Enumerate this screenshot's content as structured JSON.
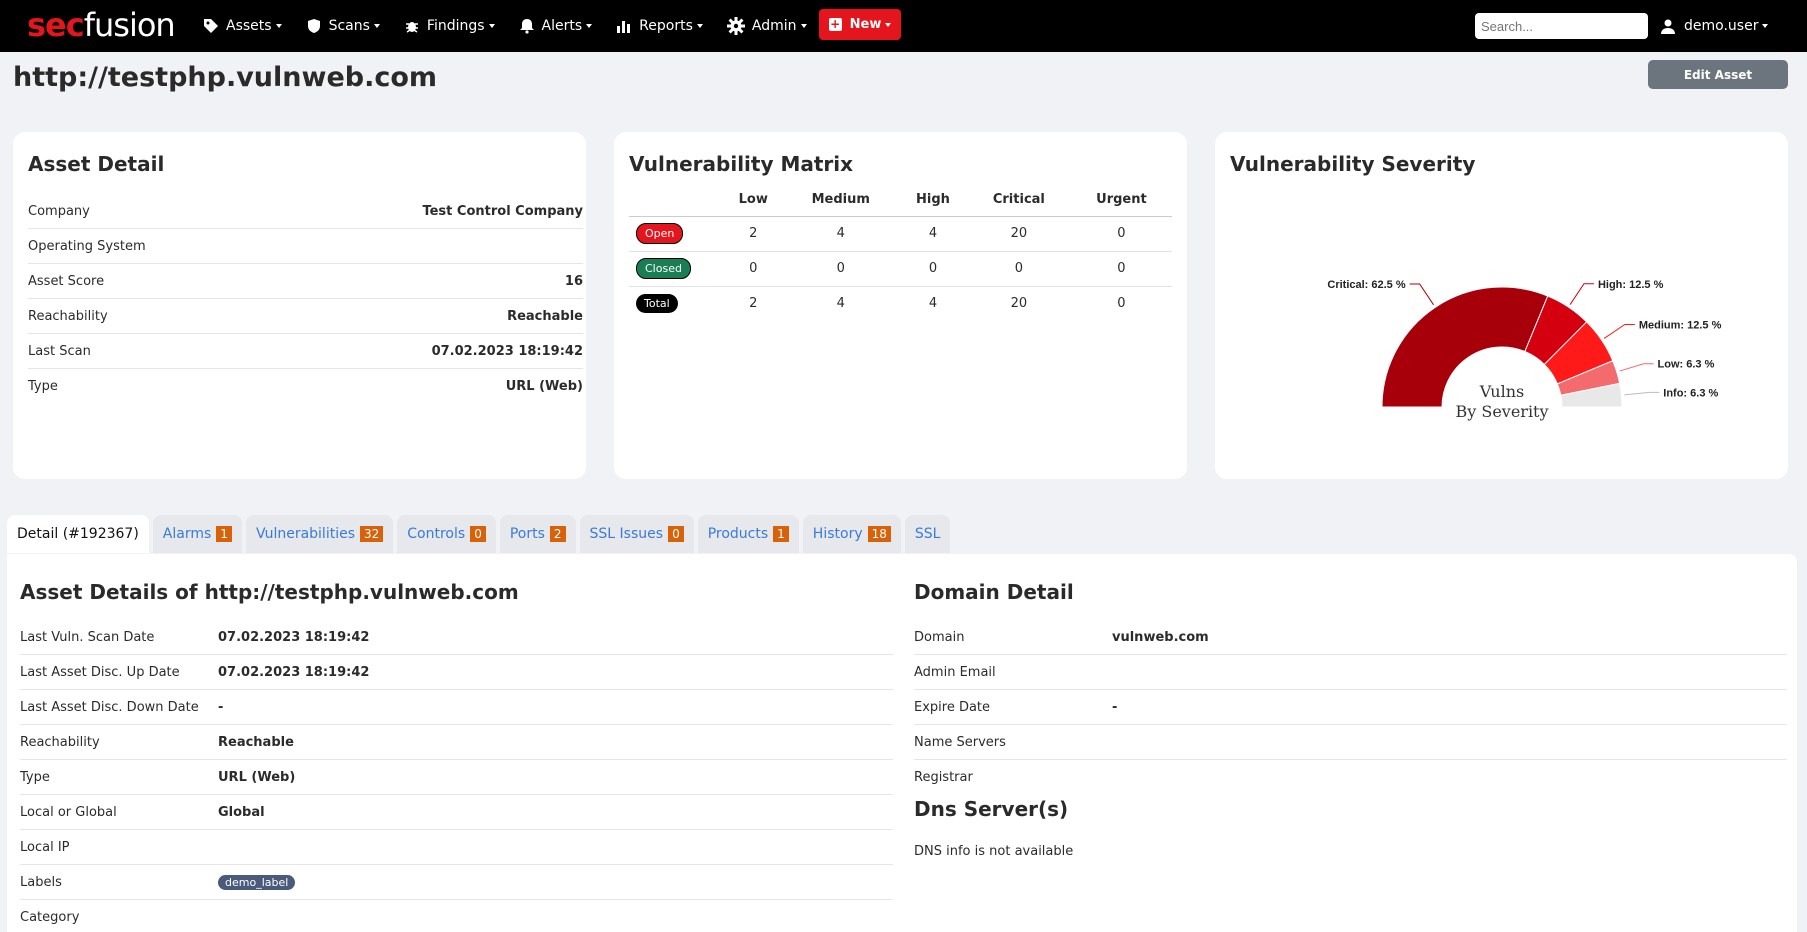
{
  "nav": {
    "logo_sec": "sec",
    "logo_fusion": "fusion",
    "items": [
      {
        "label": "Assets",
        "icon": "tag-icon"
      },
      {
        "label": "Scans",
        "icon": "shield-icon"
      },
      {
        "label": "Findings",
        "icon": "bug-icon"
      },
      {
        "label": "Alerts",
        "icon": "bell-icon"
      },
      {
        "label": "Reports",
        "icon": "bar-chart-icon"
      },
      {
        "label": "Admin",
        "icon": "gear-icon"
      }
    ],
    "new_label": "New",
    "search_placeholder": "Search...",
    "user_label": "demo.user"
  },
  "header": {
    "title": "http://testphp.vulnweb.com",
    "edit_label": "Edit Asset"
  },
  "asset_detail": {
    "title": "Asset Detail",
    "rows": [
      {
        "label": "Company",
        "value": "Test Control Company"
      },
      {
        "label": "Operating System",
        "value": ""
      },
      {
        "label": "Asset Score",
        "value": "16"
      },
      {
        "label": "Reachability",
        "value": "Reachable"
      },
      {
        "label": "Last Scan",
        "value": "07.02.2023 18:19:42"
      },
      {
        "label": "Type",
        "value": "URL (Web)"
      }
    ]
  },
  "vuln_matrix": {
    "title": "Vulnerability Matrix",
    "columns": [
      "Low",
      "Medium",
      "High",
      "Critical",
      "Urgent"
    ],
    "rows": [
      {
        "label": "Open",
        "values": [
          "2",
          "4",
          "4",
          "20",
          "0"
        ]
      },
      {
        "label": "Closed",
        "values": [
          "0",
          "0",
          "0",
          "0",
          "0"
        ]
      },
      {
        "label": "Total",
        "values": [
          "2",
          "4",
          "4",
          "20",
          "0"
        ]
      }
    ]
  },
  "chart_data": {
    "type": "pie",
    "title": "Vulnerability Severity",
    "center_label_line1": "Vulns",
    "center_label_line2": "By Severity",
    "slices": [
      {
        "name": "Critical",
        "percent": 62.5,
        "label": "Critical: 62.5 %",
        "color": "#a8000a"
      },
      {
        "name": "High",
        "percent": 12.5,
        "label": "High: 12.5 %",
        "color": "#d4000f"
      },
      {
        "name": "Medium",
        "percent": 12.5,
        "label": "Medium: 12.5 %",
        "color": "#ff1a1a"
      },
      {
        "name": "Low",
        "percent": 6.3,
        "label": "Low: 6.3 %",
        "color": "#f36a6f"
      },
      {
        "name": "Info",
        "percent": 6.3,
        "label": "Info: 6.3 %",
        "color": "#e8e8e8"
      }
    ]
  },
  "tabs": [
    {
      "label": "Detail (#192367)",
      "count": "",
      "active": true
    },
    {
      "label": "Alarms",
      "count": "1"
    },
    {
      "label": "Vulnerabilities",
      "count": "32"
    },
    {
      "label": "Controls",
      "count": "0"
    },
    {
      "label": "Ports",
      "count": "2"
    },
    {
      "label": "SSL Issues",
      "count": "0"
    },
    {
      "label": "Products",
      "count": "1"
    },
    {
      "label": "History",
      "count": "18"
    },
    {
      "label": "SSL",
      "count": ""
    }
  ],
  "asset_details": {
    "title": "Asset Details of http://testphp.vulnweb.com",
    "rows": [
      {
        "label": "Last Vuln. Scan Date",
        "value": "07.02.2023 18:19:42"
      },
      {
        "label": "Last Asset Disc. Up Date",
        "value": "07.02.2023 18:19:42"
      },
      {
        "label": "Last Asset Disc. Down Date",
        "value": "-"
      },
      {
        "label": "Reachability",
        "value": "Reachable"
      },
      {
        "label": "Type",
        "value": "URL (Web)"
      },
      {
        "label": "Local or Global",
        "value": "Global"
      },
      {
        "label": "Local IP",
        "value": ""
      },
      {
        "label": "Labels",
        "value": "demo_label"
      },
      {
        "label": "Category",
        "value": ""
      }
    ]
  },
  "domain_detail": {
    "title": "Domain Detail",
    "rows": [
      {
        "label": "Domain",
        "value": "vulnweb.com"
      },
      {
        "label": "Admin Email",
        "value": ""
      },
      {
        "label": "Expire Date",
        "value": "-"
      },
      {
        "label": "Name Servers",
        "value": ""
      },
      {
        "label": "Registrar",
        "value": ""
      }
    ],
    "dns_title": "Dns Server(s)",
    "dns_message": "DNS info is not available"
  }
}
